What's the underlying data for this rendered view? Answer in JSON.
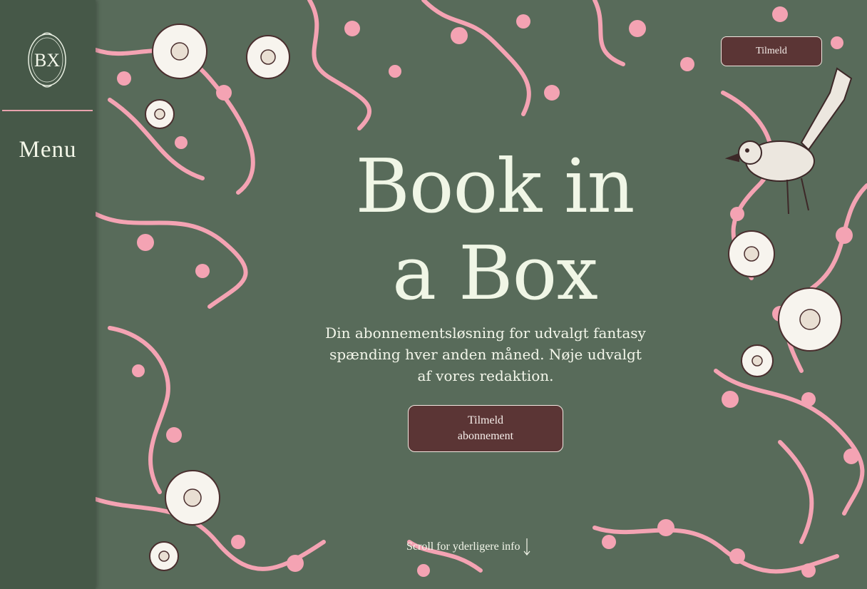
{
  "brand": {
    "logo_text": "BX"
  },
  "sidebar": {
    "menu_label": "Menu"
  },
  "header": {
    "subscribe_label": "Tilmeld"
  },
  "hero": {
    "title_line1": "Book in",
    "title_line2": "a Box",
    "tagline": "Din abonnementsløsning for udvalgt fantasy spænding hver anden måned. Nøje udvalgt af vores redaktion.",
    "cta_label": "Tilmeld abonnement"
  },
  "scroll_hint": {
    "label": "Scroll for yderligere info",
    "icon": "arrow-down-icon"
  },
  "colors": {
    "background": "#586b5a",
    "sidebar": "#465848",
    "accent_pink": "#f4a3b3",
    "button": "#5b3535",
    "title": "#f0f6e6"
  }
}
